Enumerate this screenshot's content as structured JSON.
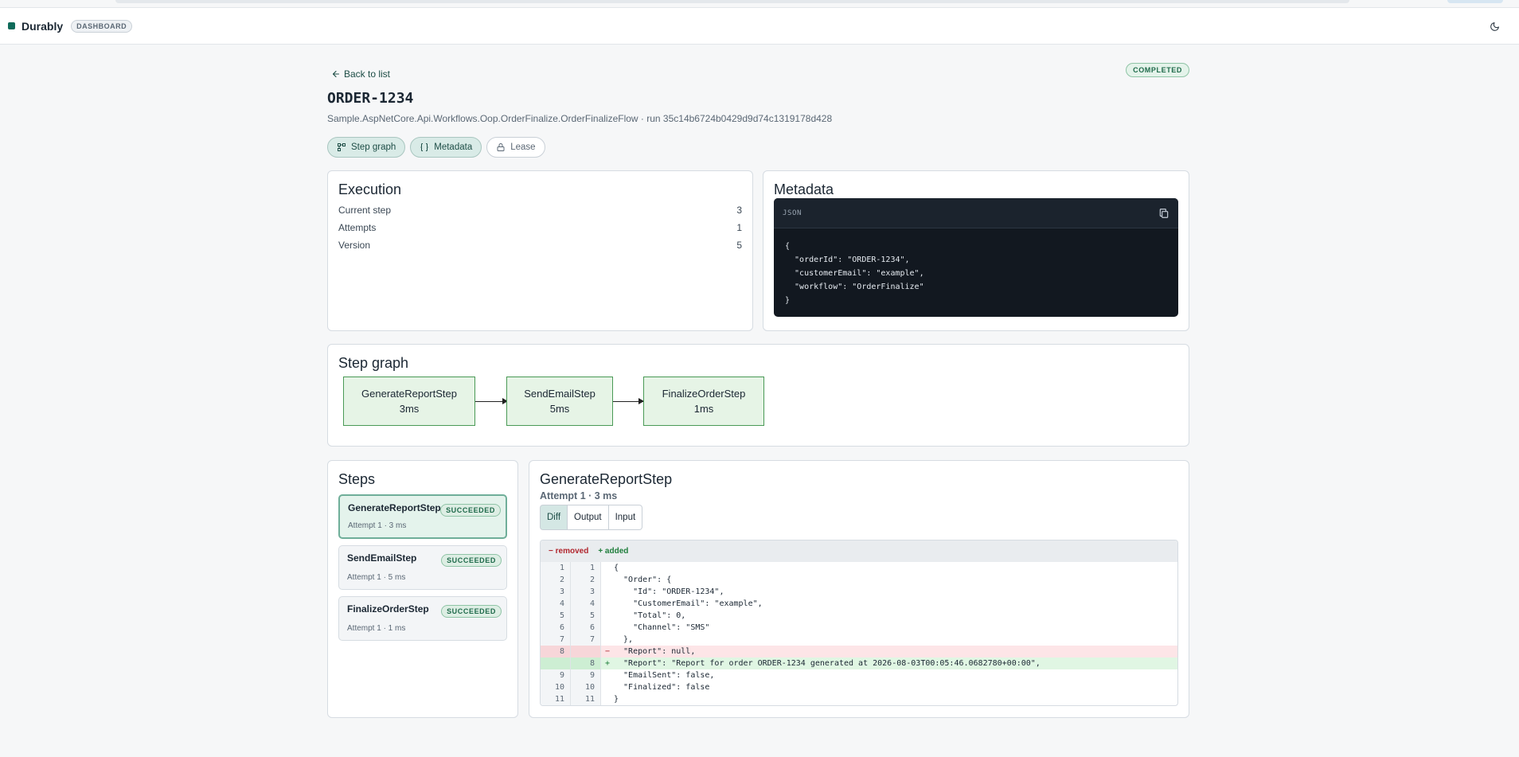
{
  "app": {
    "brand": "Durably",
    "badge": "DASHBOARD"
  },
  "header": {
    "back_label": "Back to list",
    "status": "COMPLETED",
    "title": "ORDER-1234",
    "subtitle": "Sample.AspNetCore.Api.Workflows.Oop.OrderFinalize.OrderFinalizeFlow · run 35c14b6724b0429d9d74c1319178d428",
    "chips": [
      "Step graph",
      "Metadata",
      "Lease"
    ]
  },
  "execution": {
    "title": "Execution",
    "rows": [
      {
        "label": "Current step",
        "value": "3"
      },
      {
        "label": "Attempts",
        "value": "1"
      },
      {
        "label": "Version",
        "value": "5"
      }
    ]
  },
  "metadata": {
    "title": "Metadata",
    "json_label": "JSON",
    "json_text": "{\n  \"orderId\": \"ORDER-1234\",\n  \"customerEmail\": \"example\",\n  \"workflow\": \"OrderFinalize\"\n}"
  },
  "step_graph": {
    "title": "Step graph",
    "nodes": [
      {
        "name": "GenerateReportStep",
        "duration": "3ms"
      },
      {
        "name": "SendEmailStep",
        "duration": "5ms"
      },
      {
        "name": "FinalizeOrderStep",
        "duration": "1ms"
      }
    ]
  },
  "steps": {
    "title": "Steps",
    "items": [
      {
        "name": "GenerateReportStep",
        "status": "SUCCEEDED",
        "meta": "Attempt 1 · 3 ms"
      },
      {
        "name": "SendEmailStep",
        "status": "SUCCEEDED",
        "meta": "Attempt 1 · 5 ms"
      },
      {
        "name": "FinalizeOrderStep",
        "status": "SUCCEEDED",
        "meta": "Attempt 1 · 1 ms"
      }
    ]
  },
  "detail": {
    "title": "GenerateReportStep",
    "subtitle": "Attempt 1 · 3 ms",
    "tabs": [
      "Diff",
      "Output",
      "Input"
    ],
    "legend_removed": "− removed",
    "legend_added": "+ added",
    "lines": [
      {
        "old": "1",
        "new": "1",
        "sign": "",
        "type": "ctx",
        "text": "{"
      },
      {
        "old": "2",
        "new": "2",
        "sign": "",
        "type": "ctx",
        "text": "  \"Order\": {"
      },
      {
        "old": "3",
        "new": "3",
        "sign": "",
        "type": "ctx",
        "text": "    \"Id\": \"ORDER-1234\","
      },
      {
        "old": "4",
        "new": "4",
        "sign": "",
        "type": "ctx",
        "text": "    \"CustomerEmail\": \"example\","
      },
      {
        "old": "5",
        "new": "5",
        "sign": "",
        "type": "ctx",
        "text": "    \"Total\": 0,"
      },
      {
        "old": "6",
        "new": "6",
        "sign": "",
        "type": "ctx",
        "text": "    \"Channel\": \"SMS\""
      },
      {
        "old": "7",
        "new": "7",
        "sign": "",
        "type": "ctx",
        "text": "  },"
      },
      {
        "old": "8",
        "new": "",
        "sign": "−",
        "type": "removed",
        "text": "  \"Report\": null,"
      },
      {
        "old": "",
        "new": "8",
        "sign": "+",
        "type": "added",
        "text": "  \"Report\": \"Report for order ORDER-1234 generated at 2026-08-03T00:05:46.0682780+00:00\","
      },
      {
        "old": "9",
        "new": "9",
        "sign": "",
        "type": "ctx",
        "text": "  \"EmailSent\": false,"
      },
      {
        "old": "10",
        "new": "10",
        "sign": "",
        "type": "ctx",
        "text": "  \"Finalized\": false"
      },
      {
        "old": "11",
        "new": "11",
        "sign": "",
        "type": "ctx",
        "text": "}"
      }
    ]
  }
}
